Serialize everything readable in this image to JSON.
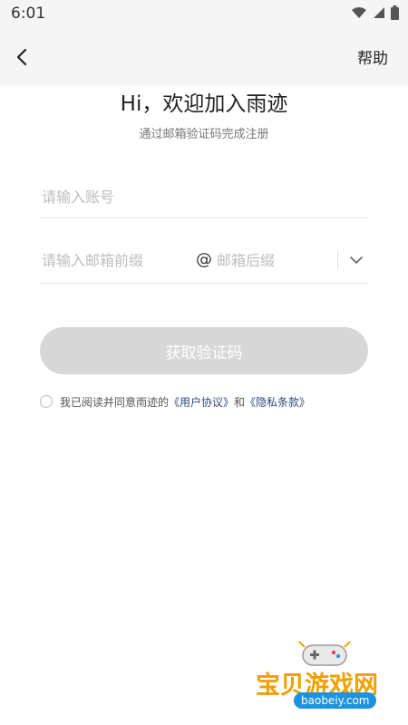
{
  "status_bar": {
    "time": "6:01"
  },
  "header": {
    "back_icon": "chevron-left-icon",
    "help_label": "帮助"
  },
  "main": {
    "title": "Hi，欢迎加入雨迹",
    "subtitle": "通过邮箱验证码完成注册",
    "account_placeholder": "请输入账号",
    "email_prefix_placeholder": "请输入邮箱前缀",
    "at_symbol": "@",
    "email_suffix_placeholder": "邮箱后缀",
    "get_code_label": "获取验证码",
    "agreement": {
      "prefix": "我已阅读并同意雨迹的",
      "user_agreement": "《用户协议》",
      "and": "和",
      "privacy_policy": "《隐私条款》"
    }
  },
  "watermark": {
    "text": "宝贝游戏网",
    "domain": "baobeiy.com"
  },
  "colors": {
    "link": "#2f4a7d",
    "button_disabled": "#d7d7d7",
    "status_bg": "#f5f5f5"
  }
}
